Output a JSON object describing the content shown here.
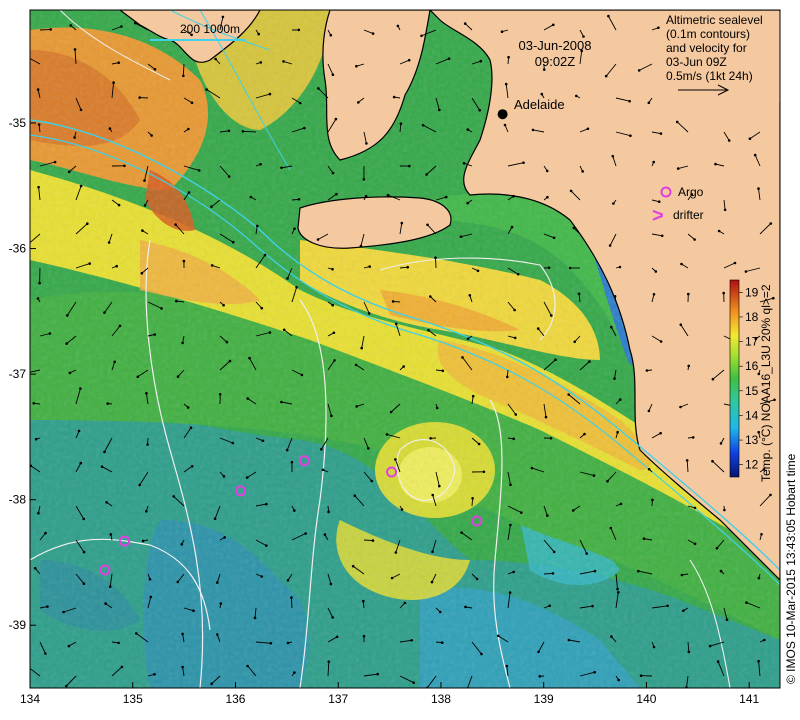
{
  "map": {
    "date": "03-Jun-2008",
    "time": "09:02Z",
    "legend": {
      "line1": "Altimetric sealevel",
      "line2": "(0.1m contours)",
      "line3": "and velocity for",
      "line4": "03-Jun 09Z",
      "line5": "0.5m/s (1kt 24h)"
    },
    "depth_contours_label": "200  1000m",
    "city": {
      "name": "Adelaide",
      "lon": 138.6,
      "lat": -34.93
    },
    "markers": {
      "argo_label": "Argo",
      "drifter_label": "drifter",
      "drifter_symbol": ">"
    },
    "colorbar": {
      "label": "Temp. (°C) NOAA16_L3U 20% ql>=2",
      "ticks": [
        "12",
        "13",
        "14",
        "15",
        "16",
        "17",
        "18",
        "19"
      ]
    },
    "credit": "© IMOS 10-Mar-2015 13:43:05 Hobart time",
    "x_ticks": [
      "134",
      "135",
      "136",
      "137",
      "138",
      "139",
      "140",
      "141"
    ],
    "y_ticks": [
      "-35",
      "-36",
      "-37",
      "-38",
      "-39"
    ],
    "lon_range": [
      134,
      141.3
    ],
    "lat_range": [
      -39.5,
      -34.1
    ],
    "argo_floats": [
      {
        "lon": 134.92,
        "lat": -38.33
      },
      {
        "lon": 134.73,
        "lat": -38.56
      },
      {
        "lon": 136.05,
        "lat": -37.93
      },
      {
        "lon": 136.67,
        "lat": -37.69
      },
      {
        "lon": 137.52,
        "lat": -37.78
      },
      {
        "lon": 138.35,
        "lat": -38.17
      },
      {
        "lon": 140.22,
        "lat": -35.39
      }
    ],
    "colors": {
      "land": "#F5C9A0",
      "coast": "#000000",
      "argo": "#E040E0",
      "contour_cyan": "#40D0E8",
      "contour_white": "#F0F0F0",
      "sst_cold": "#1020C0",
      "sst_mid": "#2DC24A",
      "sst_warm": "#F0E020",
      "sst_hot": "#E87020"
    }
  }
}
